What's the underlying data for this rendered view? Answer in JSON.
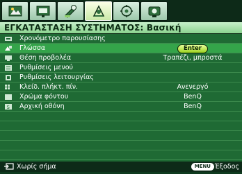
{
  "tabs": [
    {
      "name": "picture",
      "icon": "picture-icon"
    },
    {
      "name": "display",
      "icon": "display-icon"
    },
    {
      "name": "settings-basic",
      "icon": "settings-basic-icon"
    },
    {
      "name": "system-setup",
      "icon": "system-setup-icon"
    },
    {
      "name": "advanced",
      "icon": "advanced-icon"
    },
    {
      "name": "information",
      "icon": "information-icon"
    }
  ],
  "active_tab_index": 3,
  "header": {
    "title": "ΕΓΚΑΤΑΣΤΑΣΗ ΣΥΣΤΗΜΑΤΟΣ: Βασική"
  },
  "menu": {
    "items": [
      {
        "label": "Χρονόμετρο παρουσίασης",
        "value": "",
        "icon": "timer-icon"
      },
      {
        "label": "Γλώσσα",
        "value": "Enter",
        "icon": "language-icon",
        "selected": true,
        "value_is_button": true
      },
      {
        "label": "Θέση προβολέα",
        "value": "Τραπέζι, μπροστά",
        "icon": "projector-position-icon"
      },
      {
        "label": "Ρυθμίσεις μενού",
        "value": "",
        "icon": "menu-settings-icon"
      },
      {
        "label": "Ρυθμίσεις λειτουργίας",
        "value": "",
        "icon": "operation-settings-icon"
      },
      {
        "label": "Κλείδ. πλήκτ. πίν.",
        "value": "Ανενεργό",
        "icon": "panel-key-lock-icon"
      },
      {
        "label": "Χρώμα φόντου",
        "value": "BenQ",
        "icon": "background-color-icon"
      },
      {
        "label": "Αρχική οθόνη",
        "value": "BenQ",
        "icon": "splash-screen-icon"
      }
    ],
    "empty_rows": 5
  },
  "footer": {
    "source_text": "Χωρίς σήμα",
    "menu_key": "MENU",
    "exit_text": "Έξοδος"
  }
}
